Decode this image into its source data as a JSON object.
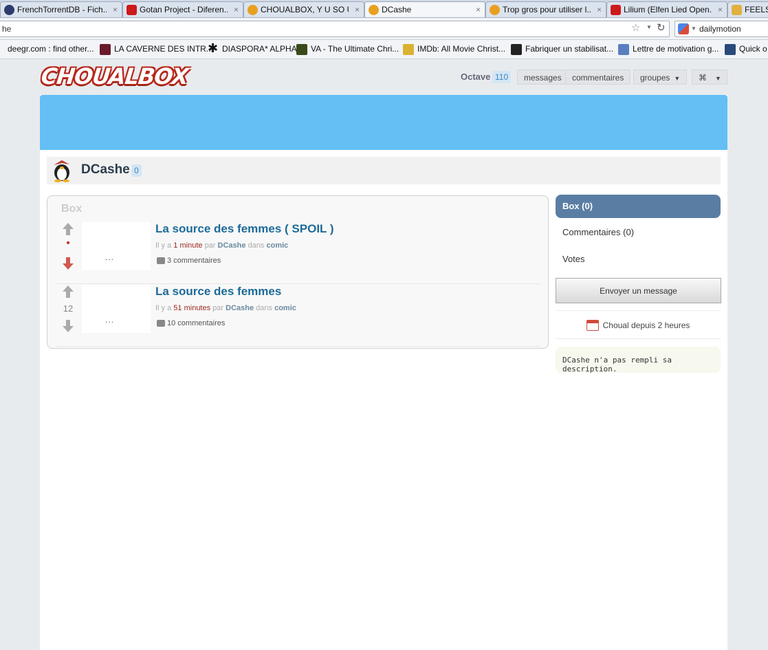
{
  "browser": {
    "tabs": [
      {
        "label": "FrenchTorrentDB - Fich...",
        "icon": "frenchtorrentdb-favicon",
        "color": "#2d3c6e"
      },
      {
        "label": "Gotan Project - Diferen...",
        "icon": "youtube-favicon",
        "color": "#cc1a1a"
      },
      {
        "label": "CHOUALBOX, Y U SO U...",
        "icon": "choualbox-favicon",
        "color": "#e8a020"
      },
      {
        "label": "DCashe",
        "icon": "choualbox-favicon",
        "color": "#e8a020"
      },
      {
        "label": "Trop gros pour utiliser l...",
        "icon": "choualbox-favicon",
        "color": "#e8a020"
      },
      {
        "label": "Lilium (Elfen Lied Open...",
        "icon": "youtube-favicon",
        "color": "#cc1a1a"
      },
      {
        "label": "FEELS",
        "icon": "generic-favicon",
        "color": "#e0b040"
      }
    ],
    "address": "he",
    "search_label": "dailymotion",
    "bookmarks": [
      {
        "label": "deegr.com : find other...",
        "icon": "deegr-icon",
        "color": "#444"
      },
      {
        "label": "LA CAVERNE DES INTR...",
        "icon": "caverne-icon",
        "color": "#6a1a2a"
      },
      {
        "label": "DIASPORA* ALPHA",
        "icon": "diaspora-icon",
        "color": "#111"
      },
      {
        "label": "VA - The Ultimate Chri...",
        "icon": "va-icon",
        "color": "#3a4a1a"
      },
      {
        "label": "IMDb: All Movie Christ...",
        "icon": "imdb-icon",
        "color": "#d9b230"
      },
      {
        "label": "Fabriquer un stabilisat...",
        "icon": "fz-icon",
        "color": "#222"
      },
      {
        "label": "Lettre de motivation g...",
        "icon": "letter-icon",
        "color": "#5a7fbf"
      },
      {
        "label": "Quick o",
        "icon": "quick-icon",
        "color": "#2a4a7a"
      }
    ]
  },
  "site": {
    "logo": "CHOUALBOX",
    "user": {
      "name": "Octave",
      "count": "110"
    },
    "nav": {
      "messages": "messages",
      "comments": "commentaires",
      "groups": "groupes",
      "options": "⌘"
    }
  },
  "profile": {
    "name": "DCashe",
    "count": "0"
  },
  "box": {
    "title": "Box",
    "posts": [
      {
        "title": "La source des femmes ( SPOIL )",
        "score": "•",
        "thumb_text": "...",
        "meta_prefix": "Il y a",
        "meta_ago": "1 minute",
        "meta_by": "par",
        "meta_author": "DCashe",
        "meta_in": "dans",
        "meta_category": "comic",
        "comments": "3 commentaires"
      },
      {
        "title": "La source des femmes",
        "score": "12",
        "thumb_text": "...",
        "meta_prefix": "Il y a",
        "meta_ago": "51 minutes",
        "meta_by": "par",
        "meta_author": "DCashe",
        "meta_in": "dans",
        "meta_category": "comic",
        "comments": "10 commentaires"
      }
    ]
  },
  "sidebar": {
    "box": "Box (0)",
    "comments": "Commentaires (0)",
    "votes": "Votes",
    "send_message": "Envoyer un message",
    "since": "Choual depuis 2 heures",
    "description": "DCashe n'a pas rempli sa description."
  },
  "colors": {
    "banner": "#63bff4",
    "link": "#1c6b98",
    "sidebar_active": "#5a7ea3",
    "logo_red": "#b8271b"
  }
}
